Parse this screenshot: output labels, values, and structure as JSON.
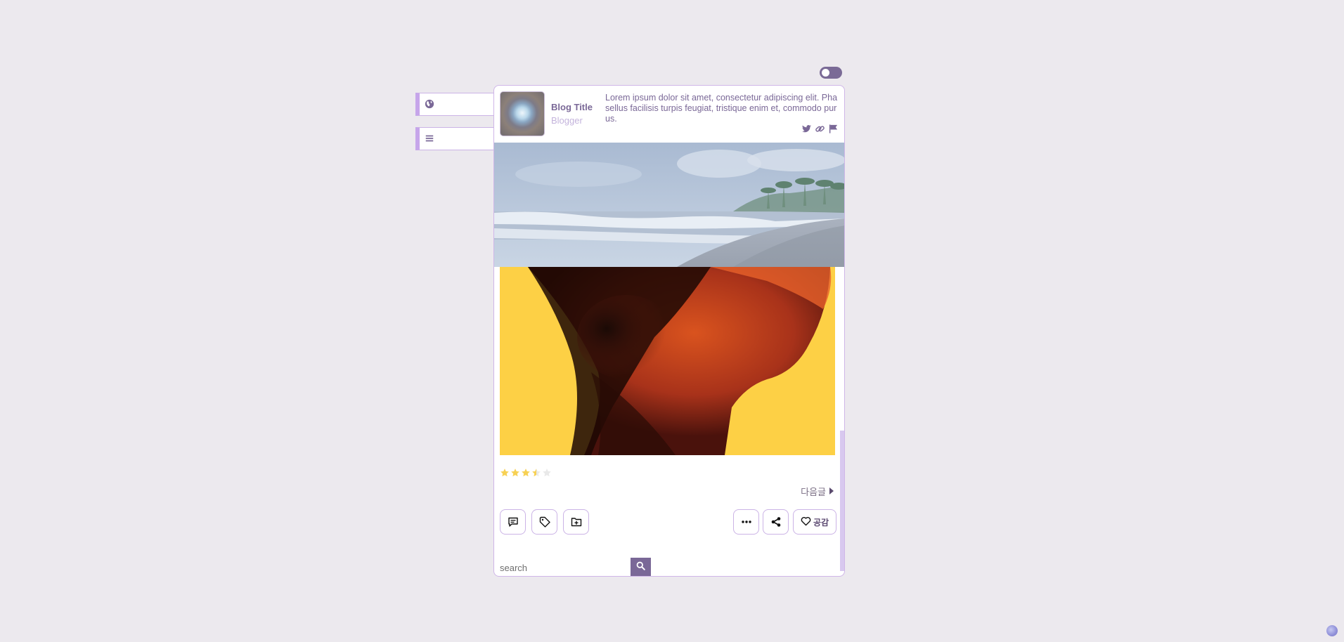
{
  "header": {
    "title": "Blog Title",
    "role": "Blogger",
    "description": "Lorem ipsum dolor sit amet, consectetur adipiscing elit. Phasellus facilisis turpis feugiat, tristique enim et, commodo purus."
  },
  "social": {
    "icons": [
      "twitter-icon",
      "link-icon",
      "flag-icon"
    ]
  },
  "side_tabs": {
    "icons": [
      "globe-icon",
      "menu-icon"
    ]
  },
  "post": {
    "rating": 3.5,
    "rating_max": 5,
    "next_label": "다음글"
  },
  "actions": {
    "left": [
      "comment-icon",
      "tag-icon",
      "folder-add-icon"
    ],
    "right": [
      "more-icon",
      "share-icon"
    ],
    "like_label": "공감"
  },
  "search": {
    "placeholder": "search"
  },
  "colors": {
    "accent": "#7a6897",
    "border": "#cfb6e8",
    "tab_accent": "#c6a5ea",
    "background": "#ece9ee",
    "star": "#f7d154"
  }
}
